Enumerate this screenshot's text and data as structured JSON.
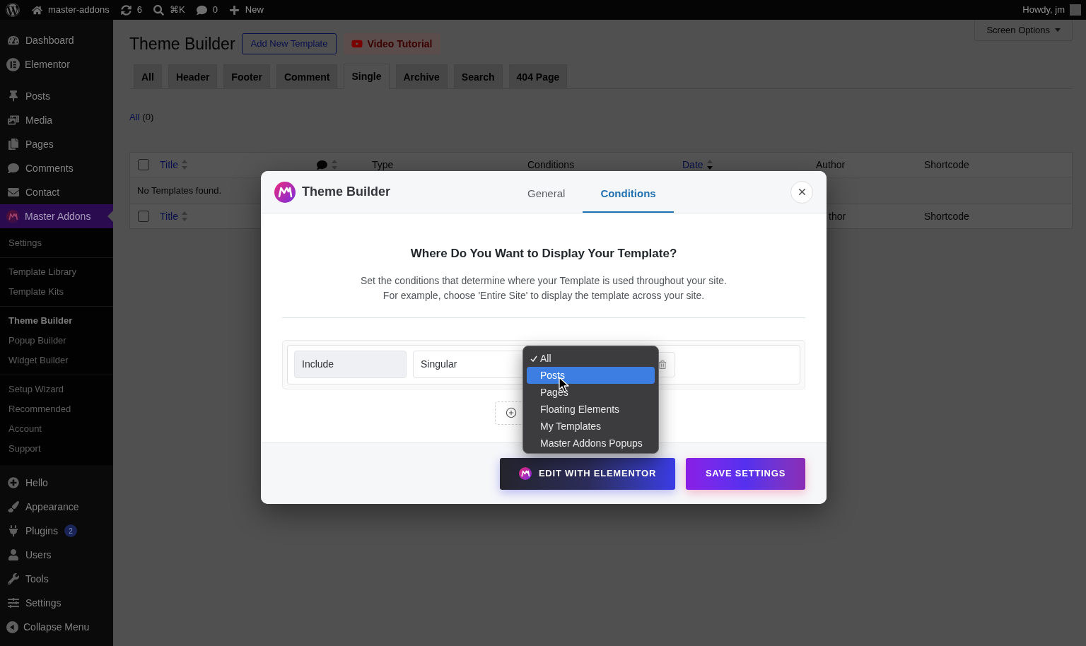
{
  "admin_bar": {
    "items": [
      {
        "kind": "home",
        "label": "master-addons"
      },
      {
        "kind": "updates",
        "label": "6"
      },
      {
        "kind": "search",
        "label": "⌘K"
      },
      {
        "kind": "comments",
        "label": "0"
      },
      {
        "kind": "new",
        "label": "New"
      }
    ],
    "greeting": "Howdy, jm"
  },
  "sidebar": {
    "groups": [
      [
        {
          "kind": "dashboard",
          "label": "Dashboard",
          "selected": false
        },
        {
          "kind": "elementor",
          "label": "Elementor",
          "selected": false
        }
      ],
      [
        {
          "kind": "posts",
          "label": "Posts",
          "selected": false
        },
        {
          "kind": "media",
          "label": "Media",
          "selected": false
        },
        {
          "kind": "pages",
          "label": "Pages",
          "selected": false
        },
        {
          "kind": "comments",
          "label": "Comments",
          "selected": false
        },
        {
          "kind": "contact",
          "label": "Contact",
          "selected": false
        },
        {
          "kind": "addon",
          "label": "Master Addons",
          "selected": true,
          "submenu": [
            [
              {
                "label": "Settings",
                "selected": false
              }
            ],
            [
              {
                "label": "Template Library",
                "selected": false
              },
              {
                "label": "Template Kits",
                "selected": false
              }
            ],
            [
              {
                "label": "Theme Builder",
                "selected": true
              },
              {
                "label": "Popup Builder",
                "selected": false
              },
              {
                "label": "Widget Builder",
                "selected": false
              }
            ],
            [
              {
                "label": "Setup Wizard",
                "selected": false
              },
              {
                "label": "Recommended",
                "selected": false
              },
              {
                "label": "Account",
                "selected": false
              },
              {
                "label": "Support",
                "selected": false
              }
            ]
          ]
        },
        {
          "kind": "hello",
          "label": "Hello",
          "selected": false
        },
        {
          "kind": "appearance",
          "label": "Appearance",
          "selected": false
        },
        {
          "kind": "plugins",
          "label": "Plugins",
          "selected": false,
          "badge": "2"
        },
        {
          "kind": "users",
          "label": "Users",
          "selected": false
        },
        {
          "kind": "tools",
          "label": "Tools",
          "selected": false
        },
        {
          "kind": "settings",
          "label": "Settings",
          "selected": false
        },
        {
          "kind": "collapse",
          "label": "Collapse Menu",
          "selected": false
        }
      ]
    ]
  },
  "page": {
    "title": "Theme Builder",
    "actions": [
      {
        "kind": "add",
        "label": "Add New Template"
      },
      {
        "kind": "video",
        "label": "Video Tutorial"
      }
    ],
    "screen_options": "Screen Options",
    "tabs": [
      {
        "label": "All",
        "selected": false
      },
      {
        "label": "Header",
        "selected": false
      },
      {
        "label": "Footer",
        "selected": false
      },
      {
        "label": "Comment",
        "selected": false
      },
      {
        "label": "Single",
        "selected": true
      },
      {
        "label": "Archive",
        "selected": false
      },
      {
        "label": "Search",
        "selected": false
      },
      {
        "label": "404 Page",
        "selected": false
      }
    ],
    "filter": {
      "label": "All",
      "count": "(0)"
    },
    "table": {
      "columns": [
        {
          "kind": "checkbox",
          "checked": false
        },
        {
          "kind": "sortable",
          "label": "Title",
          "sorted": false
        },
        {
          "kind": "comments",
          "sorted": false
        },
        {
          "kind": "text",
          "label": "Type"
        },
        {
          "kind": "text",
          "label": "Conditions"
        },
        {
          "kind": "sortable",
          "label": "Date",
          "sorted": true
        },
        {
          "kind": "text",
          "label": "Author"
        },
        {
          "kind": "text",
          "label": "Shortcode"
        }
      ],
      "empty_message": "No Templates found.",
      "footer": [
        {
          "kind": "checkbox",
          "checked": false
        },
        {
          "kind": "sortable",
          "label": "Title",
          "sorted": false
        },
        {
          "kind": "text",
          "label": "thor"
        },
        {
          "kind": "text",
          "label": "Shortcode"
        }
      ]
    }
  },
  "modal": {
    "title": "Theme Builder",
    "tabs": [
      {
        "label": "General",
        "selected": false
      },
      {
        "label": "Conditions",
        "selected": true
      }
    ],
    "heading": "Where Do You Want to Display Your Template?",
    "description": [
      "Set the conditions that determine where your Template is used throughout your site.",
      "For example, choose 'Entire Site' to display the template across your site."
    ],
    "condition": {
      "mode": "Include",
      "type": "Singular"
    },
    "dropdown": {
      "options": [
        {
          "label": "All",
          "checked": true,
          "highlighted": false
        },
        {
          "label": "Posts",
          "checked": false,
          "highlighted": true
        },
        {
          "label": "Pages",
          "checked": false,
          "highlighted": false
        },
        {
          "label": "Floating Elements",
          "checked": false,
          "highlighted": false
        },
        {
          "label": "My Templates",
          "checked": false,
          "highlighted": false
        },
        {
          "label": "Master Addons Popups",
          "checked": false,
          "highlighted": false
        }
      ]
    },
    "buttons": [
      {
        "kind": "elementor",
        "label": "EDIT WITH ELEMENTOR"
      },
      {
        "kind": "save",
        "label": "SAVE SETTINGS"
      }
    ]
  }
}
